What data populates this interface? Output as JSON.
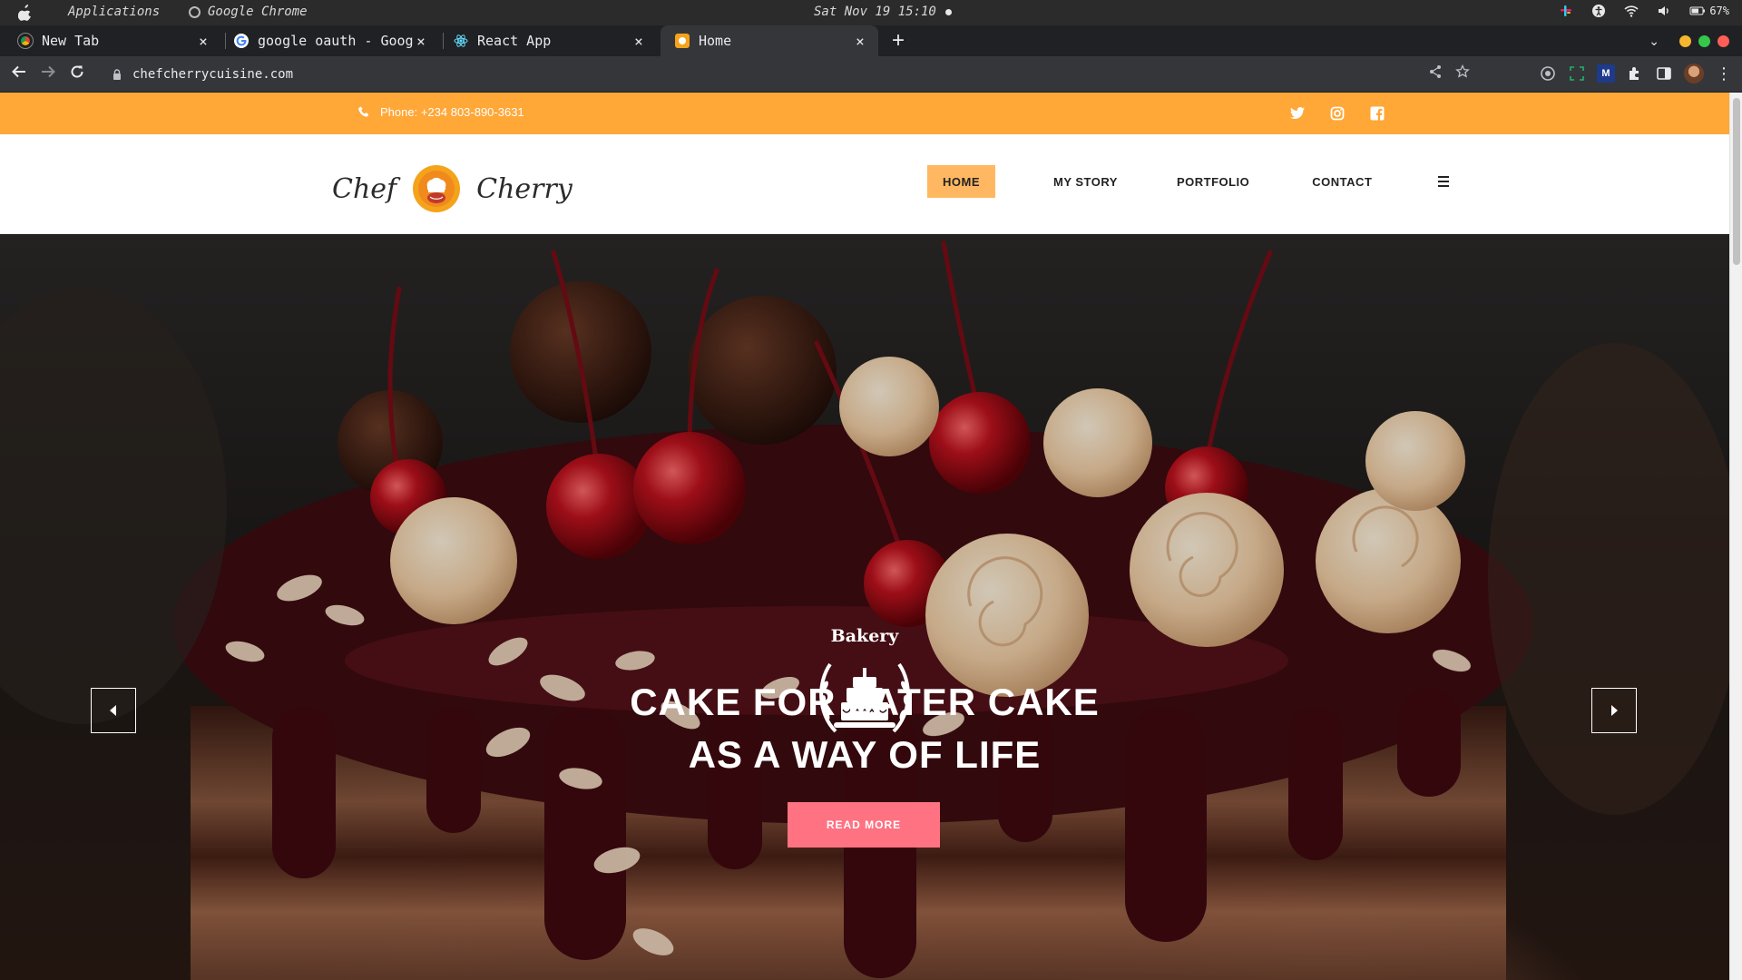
{
  "os": {
    "apps_label": "Applications",
    "chrome_label": "Google Chrome",
    "clock": "Sat Nov 19 15:10",
    "battery": "67%"
  },
  "tabs": [
    {
      "title": "New Tab",
      "icon": "chrome-icon"
    },
    {
      "title": "google oauth - Goog",
      "icon": "google-icon"
    },
    {
      "title": "React App",
      "icon": "react-icon"
    },
    {
      "title": "Home",
      "icon": "site-favicon-icon"
    }
  ],
  "active_tab_index": 3,
  "browser": {
    "url": "chefcherrycuisine.com"
  },
  "site": {
    "phone": "Phone: +234 803-890-3631",
    "logo_left": "Chef",
    "logo_right": "Cherry",
    "nav": [
      "HOME",
      "MY STORY",
      "PORTFOLIO",
      "CONTACT"
    ],
    "active_nav": "HOME",
    "hero": {
      "emblem_text": "Bakery",
      "line1": "CAKE FOR LATER CAKE",
      "line2": "AS A WAY OF LIFE",
      "cta": "READ MORE"
    }
  },
  "colors": {
    "topbar": "#ffa737",
    "nav_active": "#ffb861",
    "cta": "#ff7282"
  }
}
